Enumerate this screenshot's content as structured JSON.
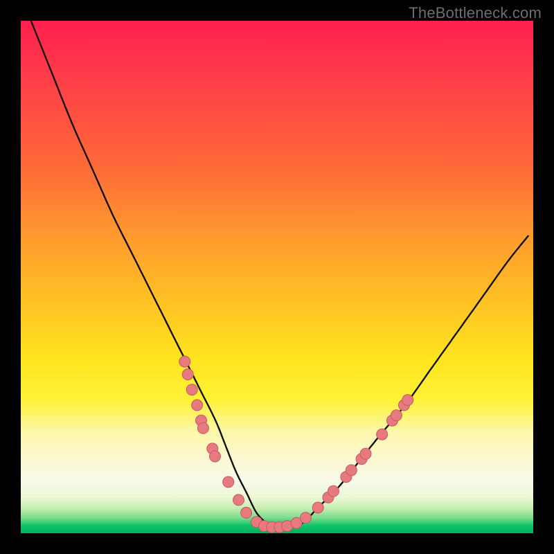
{
  "watermark": "TheBottleneck.com",
  "colors": {
    "frame": "#000000",
    "curve_stroke": "#101010",
    "marker_fill": "#e67a7f",
    "marker_stroke": "#c55a62"
  },
  "chart_data": {
    "type": "line",
    "title": "",
    "xlabel": "",
    "ylabel": "",
    "xlim": [
      0,
      100
    ],
    "ylim": [
      0,
      100
    ],
    "note": "Axes unlabeled; values are percentage of plot area (0 at left/bottom, 100 at right/top). Curve resembles a bottleneck V.",
    "series": [
      {
        "name": "bottleneck-curve",
        "x": [
          2,
          6,
          10,
          14,
          18,
          22,
          26,
          29,
          32,
          35,
          38,
          40,
          42,
          44,
          46,
          48,
          50,
          52,
          55,
          58,
          62,
          66,
          70,
          75,
          80,
          85,
          90,
          95,
          99
        ],
        "y": [
          100,
          90,
          80,
          71,
          62,
          54,
          46,
          40,
          34,
          28,
          22,
          17,
          12,
          8,
          4,
          2,
          1,
          1,
          2,
          5,
          9,
          14,
          19,
          25,
          32,
          39,
          46,
          53,
          58
        ]
      }
    ],
    "markers": {
      "name": "sample-points",
      "comment": "Salmon dots clustered on both arms near the valley and along valley floor.",
      "points": [
        {
          "x": 32.0,
          "y": 33.5
        },
        {
          "x": 32.6,
          "y": 31.0
        },
        {
          "x": 33.4,
          "y": 28.0
        },
        {
          "x": 34.4,
          "y": 25.0
        },
        {
          "x": 35.2,
          "y": 22.0
        },
        {
          "x": 35.6,
          "y": 20.5
        },
        {
          "x": 37.4,
          "y": 16.5
        },
        {
          "x": 37.9,
          "y": 15.0
        },
        {
          "x": 40.5,
          "y": 10.0
        },
        {
          "x": 42.5,
          "y": 6.5
        },
        {
          "x": 44.0,
          "y": 4.0
        },
        {
          "x": 46.0,
          "y": 2.2
        },
        {
          "x": 47.5,
          "y": 1.4
        },
        {
          "x": 49.0,
          "y": 1.2
        },
        {
          "x": 50.5,
          "y": 1.2
        },
        {
          "x": 52.0,
          "y": 1.4
        },
        {
          "x": 53.8,
          "y": 2.0
        },
        {
          "x": 55.6,
          "y": 3.0
        },
        {
          "x": 58.0,
          "y": 5.0
        },
        {
          "x": 60.0,
          "y": 7.0
        },
        {
          "x": 61.0,
          "y": 8.2
        },
        {
          "x": 63.5,
          "y": 11.0
        },
        {
          "x": 64.5,
          "y": 12.3
        },
        {
          "x": 66.5,
          "y": 14.5
        },
        {
          "x": 67.3,
          "y": 15.5
        },
        {
          "x": 70.5,
          "y": 19.3
        },
        {
          "x": 72.5,
          "y": 22.0
        },
        {
          "x": 73.3,
          "y": 23.0
        },
        {
          "x": 74.8,
          "y": 25.0
        },
        {
          "x": 75.5,
          "y": 26.0
        }
      ]
    }
  }
}
